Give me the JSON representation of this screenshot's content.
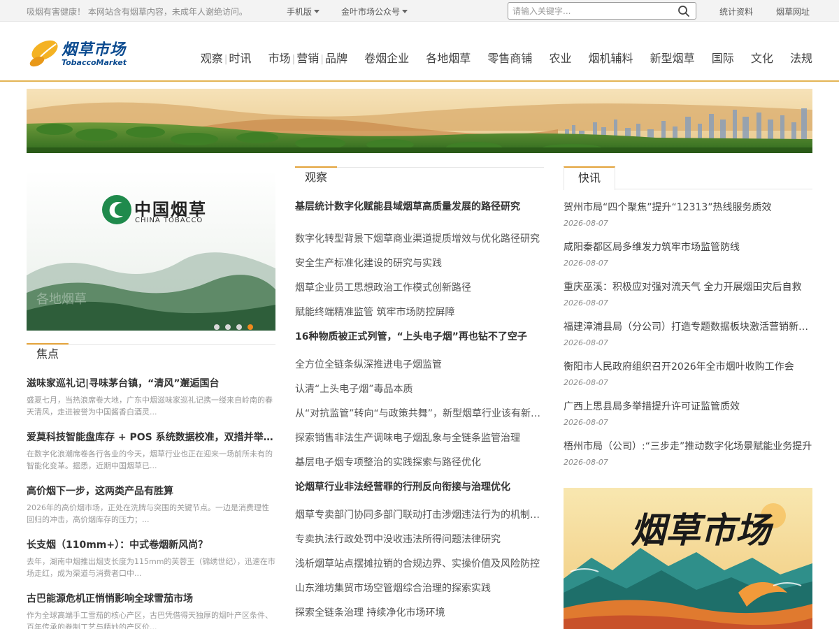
{
  "topbar": {
    "notice": "吸烟有害健康！ 本网站含有烟草内容，未成年人谢绝访问。",
    "mobile_label": "手机版",
    "wechat_label": "金叶市场公众号",
    "search_placeholder": "请输入关键字...",
    "stats_link": "统计资料",
    "sites_link": "烟草网址"
  },
  "logo": {
    "cn": "烟草市场",
    "en": "TobaccoMarket"
  },
  "nav": {
    "items": [
      "观察",
      "时讯",
      "市场",
      "营销",
      "品牌",
      "卷烟企业",
      "各地烟草",
      "零售商铺",
      "农业",
      "烟机辅料",
      "新型烟草",
      "国际",
      "文化",
      "法规"
    ]
  },
  "slider": {
    "brand_cn": "中国烟草",
    "brand_en": "CHINA TOBACCO",
    "slide_count": 4,
    "active_index": 3
  },
  "focus": {
    "heading": "焦点",
    "items": [
      {
        "title": "滋味家巡礼记|寻味茅台镇，“清风”邂逅国台",
        "desc": "盛夏七月，当热浪席卷大地，广东中烟滋味家巡礼记携一缕来自岭南的春天清风，走进被誉为中国酱香白酒灵..."
      },
      {
        "title": "爱莫科技智能盘库存 + POS 系统数据校准，双措并举筑牢市场秩序",
        "desc": "在数字化浪潮席卷各行各业的今天，烟草行业也正在迎来一场前所未有的智能化变革。据悉，近期中国烟草已..."
      },
      {
        "title": "高价烟下一步，这两类产品有胜算",
        "desc": "2026年的高价烟市场，正处在洗牌与突围的关键节点。一边是消费理性回归的冲击，高价烟库存的压力；..."
      },
      {
        "title": "长支烟（110mm+）：中式卷烟新风尚？",
        "desc": "去年，湖南中烟推出烟支长度为115mm的芙蓉王（锦绣世纪），迅速在市场走红，成为渠道与消费者口中..."
      },
      {
        "title": "古巴能源危机正悄悄影响全球雪茄市场",
        "desc": "作为全球高端手工雪茄的核心产区，古巴凭借得天独厚的烟叶产区条件、百年传承的卷制工艺与精妙的产区价..."
      }
    ]
  },
  "observe": {
    "heading": "观察",
    "rows": [
      {
        "text": "基层统计数字化赋能县域烟草高质量发展的路径研究",
        "lead": true
      },
      {
        "text": "数字化转型背景下烟草商业渠道提质增效与优化路径研究",
        "lead": false
      },
      {
        "text": "安全生产标准化建设的研究与实践",
        "lead": false
      },
      {
        "text": "烟草企业员工思想政治工作模式创新路径",
        "lead": false
      },
      {
        "text": "赋能终端精准监管 筑牢市场防控屏障",
        "lead": false
      },
      {
        "text": "16种物质被正式列管，“上头电子烟”再也钻不了空子",
        "lead": true
      },
      {
        "text": "全方位全链条纵深推进电子烟监管",
        "lead": false
      },
      {
        "text": "认清“上头电子烟”毒品本质",
        "lead": false
      },
      {
        "text": "从“对抗监管”转向“与政策共舞”，新型烟草行业该有新思维",
        "lead": false
      },
      {
        "text": "探索销售非法生产调味电子烟乱象与全链条监管治理",
        "lead": false
      },
      {
        "text": "基层电子烟专项整治的实践探索与路径优化",
        "lead": false
      },
      {
        "text": "论烟草行业非法经营罪的行刑反向衔接与治理优化",
        "lead": true
      },
      {
        "text": "烟草专卖部门协同多部门联动打击涉烟违法行为的机制研究",
        "lead": false
      },
      {
        "text": "专卖执法行政处罚中没收违法所得问题法律研究",
        "lead": false
      },
      {
        "text": "浅析烟草站点摆摊拉销的合规边界、实操价值及风险防控",
        "lead": false
      },
      {
        "text": "山东潍坊集贸市场空管烟综合治理的探索实践",
        "lead": false
      },
      {
        "text": "探索全链条治理 持续净化市场环境",
        "lead": false
      }
    ]
  },
  "news": {
    "heading": "快讯",
    "items": [
      {
        "title": "贺州市局“四个聚焦”提升“12313”热线服务质效",
        "date": "2026-08-07"
      },
      {
        "title": "咸阳秦都区局多维发力筑牢市场监管防线",
        "date": "2026-08-07"
      },
      {
        "title": "重庆巫溪：积极应对强对流天气 全力开展烟田灾后自救",
        "date": "2026-08-07"
      },
      {
        "title": "福建漳浦县局（分公司）打造专题数据板块激活营销新动能",
        "date": "2026-08-07"
      },
      {
        "title": "衡阳市人民政府组织召开2026年全市烟叶收购工作会",
        "date": "2026-08-07"
      },
      {
        "title": "广西上思县局多举措提升许可证监管质效",
        "date": "2026-08-07"
      },
      {
        "title": "梧州市局（公司）:“三步走”推动数字化场景赋能业务提升",
        "date": "2026-08-07"
      }
    ]
  },
  "poster": {
    "calligraphy": "烟草市场"
  },
  "colors": {
    "accent": "#e3a33a",
    "brand_blue": "#0a4a8f",
    "tobacco_green": "#1f8a4c",
    "dot_active": "#f08a1d"
  }
}
